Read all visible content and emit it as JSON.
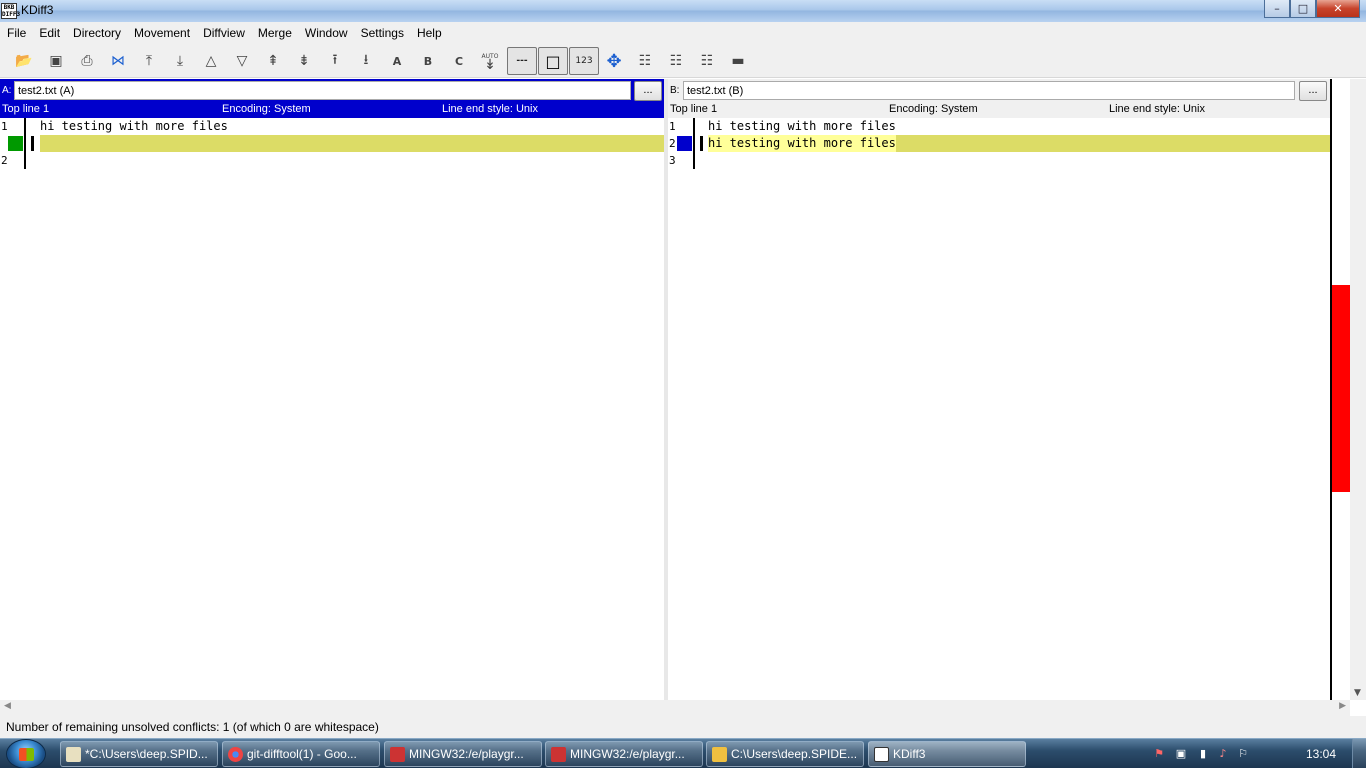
{
  "window": {
    "title": "KDiff3",
    "icon_text": "BKB\nDIFF3",
    "minimize": "–",
    "maximize": "□",
    "close": "✕"
  },
  "menu": [
    "File",
    "Edit",
    "Directory",
    "Movement",
    "Diffview",
    "Merge",
    "Window",
    "Settings",
    "Help"
  ],
  "toolbar": {
    "items": [
      {
        "icon": "open-folder-icon",
        "glyph": "📂"
      },
      {
        "icon": "save-icon",
        "glyph": "▣"
      },
      {
        "icon": "print-icon",
        "glyph": "⎙"
      },
      {
        "icon": "split-merge-icon",
        "glyph": "⋈"
      },
      {
        "icon": "go-top-icon",
        "glyph": "⤒"
      },
      {
        "icon": "go-bottom-icon",
        "glyph": "⤓"
      },
      {
        "icon": "prev-delta-icon",
        "glyph": "△"
      },
      {
        "icon": "next-delta-icon",
        "glyph": "▽"
      },
      {
        "icon": "prev-conflict-icon",
        "glyph": "⇞"
      },
      {
        "icon": "next-conflict-icon",
        "glyph": "⇟"
      },
      {
        "icon": "prev-unsolved-icon",
        "glyph": "⭱"
      },
      {
        "icon": "next-unsolved-icon",
        "glyph": "⭳"
      },
      {
        "icon": "select-a-icon",
        "glyph": "A"
      },
      {
        "icon": "select-b-icon",
        "glyph": "B"
      },
      {
        "icon": "select-c-icon",
        "glyph": "C"
      },
      {
        "icon": "auto-advance-icon",
        "glyph": "↡"
      },
      {
        "icon": "show-whitespace-icon",
        "glyph": "---"
      },
      {
        "icon": "show-whitespace-chars-icon",
        "glyph": "□"
      },
      {
        "icon": "line-numbers-icon",
        "glyph": "123"
      },
      {
        "icon": "move-icon",
        "glyph": "✥"
      },
      {
        "icon": "window-a-icon",
        "glyph": "☷"
      },
      {
        "icon": "window-b-icon",
        "glyph": "☷"
      },
      {
        "icon": "window-c-icon",
        "glyph": "☷"
      },
      {
        "icon": "hide-icon",
        "glyph": "▬"
      }
    ],
    "auto_label": "AUTO"
  },
  "pane_a": {
    "prefix": "A:",
    "file": "test2.txt (A)",
    "browse": "...",
    "top_line": "Top line 1",
    "encoding": "Encoding: System",
    "line_end": "Line end style: Unix",
    "lines": [
      {
        "num": "1",
        "text": "hi testing with more files"
      },
      {
        "num": "",
        "text": ""
      },
      {
        "num": "2",
        "text": ""
      }
    ],
    "marker_color": "#009900"
  },
  "pane_b": {
    "prefix": "B:",
    "file": "test2.txt (B)",
    "browse": "...",
    "top_line": "Top line 1",
    "encoding": "Encoding: System",
    "line_end": "Line end style: Unix",
    "lines": [
      {
        "num": "1",
        "text": "hi testing with more files"
      },
      {
        "num": "2",
        "text": "hi testing with more files"
      },
      {
        "num": "3",
        "text": ""
      }
    ],
    "marker_color": "#0000cc"
  },
  "colors": {
    "highlight": "#dcdc66",
    "active_header": "#0000cc",
    "conflict_overview": "#ff0000"
  },
  "status": "Number of remaining unsolved conflicts: 1 (of which 0 are whitespace)",
  "taskbar": {
    "tasks": [
      {
        "label": "*C:\\Users\\deep.SPID...",
        "icon": "notepad-icon",
        "color": "#e8e0c0"
      },
      {
        "label": "git-difftool(1) - Goo...",
        "icon": "chrome-icon",
        "color": "#e44"
      },
      {
        "label": "MINGW32:/e/playgr...",
        "icon": "git-bash-icon",
        "color": "#c33"
      },
      {
        "label": "MINGW32:/e/playgr...",
        "icon": "git-bash-icon",
        "color": "#c33"
      },
      {
        "label": "C:\\Users\\deep.SPIDE...",
        "icon": "folder-icon",
        "color": "#f0c040"
      },
      {
        "label": "KDiff3",
        "icon": "kdiff3-icon",
        "color": "#fff"
      }
    ],
    "clock": "13:04"
  }
}
